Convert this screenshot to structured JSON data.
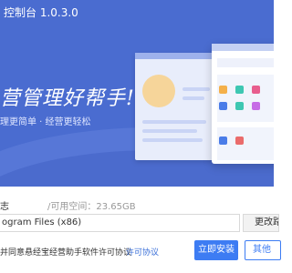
{
  "window": {
    "title": "控制台 1.0.3.0"
  },
  "banner": {
    "slogan": "营管理好帮手!",
    "subslogan": "理更简单 · 经营更轻松"
  },
  "install": {
    "path_label": "志",
    "space_label": "/可用空间：23.65GB",
    "path_value": "ogram Files (x86)",
    "change_label": "更改路",
    "agree_text": "并同意悬经宝经营助手软件许可协议",
    "license_link": "许可协议",
    "install_label": "立即安装",
    "other_label": "其他"
  },
  "colors": {
    "banner": "#4a6cd0",
    "accent": "#3d7cf3",
    "tiles": [
      "#f4b04a",
      "#3ec7b2",
      "#e85e8e",
      "#4a7ce8",
      "#3ec7b2",
      "#c66ce6",
      "#4a7ce8",
      "#ea6b6b"
    ]
  }
}
